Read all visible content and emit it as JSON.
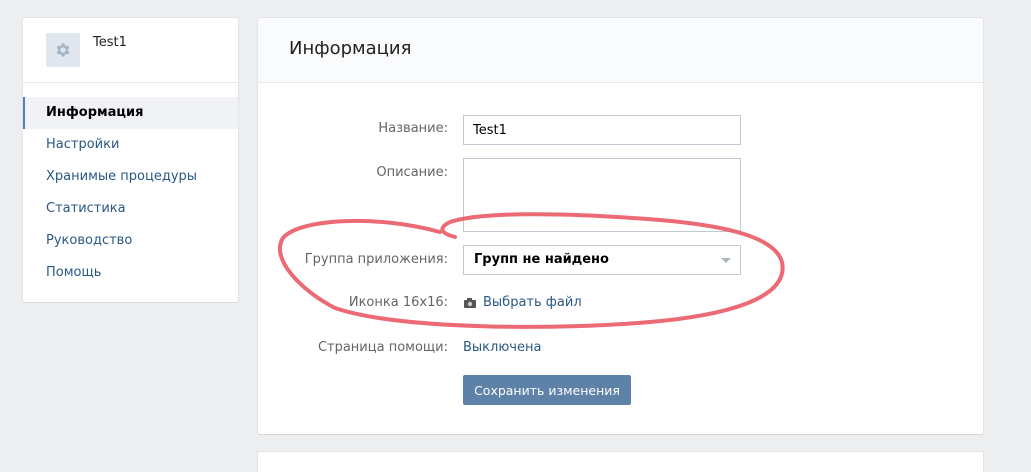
{
  "app": {
    "name": "Test1",
    "icon": "gear-icon"
  },
  "sidebar": {
    "items": [
      {
        "label": "Информация",
        "active": true
      },
      {
        "label": "Настройки"
      },
      {
        "label": "Хранимые процедуры"
      },
      {
        "label": "Статистика"
      },
      {
        "label": "Руководство"
      },
      {
        "label": "Помощь"
      }
    ]
  },
  "main": {
    "title": "Информация",
    "form": {
      "name_label": "Название:",
      "name_value": "Test1",
      "description_label": "Описание:",
      "description_value": "",
      "group_label": "Группа приложения:",
      "group_value": "Групп не найдено",
      "icon_label": "Иконка 16x16:",
      "icon_link": "Выбрать файл",
      "help_label": "Страница помощи:",
      "help_value": "Выключена",
      "save_label": "Сохранить изменения"
    }
  },
  "colors": {
    "background": "#edeef0",
    "link": "#2a5885",
    "accent": "#5181b8",
    "button": "#5e81a8",
    "annotation": "#e8505b"
  }
}
